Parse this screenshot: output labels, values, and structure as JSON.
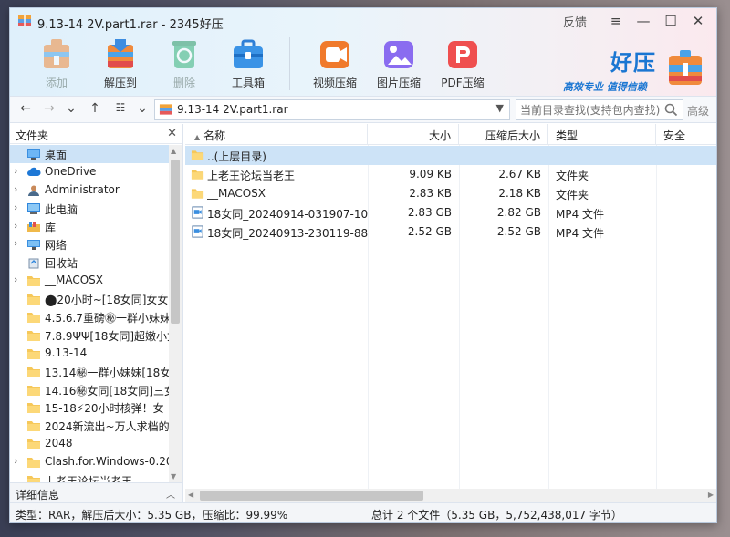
{
  "window": {
    "title": "9.13-14 2V.part1.rar - 2345好压",
    "feedback": "反馈"
  },
  "toolbar": {
    "items": [
      {
        "label": "添加",
        "icon": "add-icon",
        "disabled": true
      },
      {
        "label": "解压到",
        "icon": "extract-icon",
        "disabled": false
      },
      {
        "label": "删除",
        "icon": "delete-icon",
        "disabled": true
      },
      {
        "label": "工具箱",
        "icon": "toolbox-icon",
        "disabled": false
      },
      {
        "label": "视频压缩",
        "icon": "video-compress-icon",
        "disabled": false
      },
      {
        "label": "图片压缩",
        "icon": "image-compress-icon",
        "disabled": false
      },
      {
        "label": "PDF压缩",
        "icon": "pdf-compress-icon",
        "disabled": false
      }
    ]
  },
  "brand": {
    "name": "好压",
    "slogan": "高效专业 值得信赖"
  },
  "address": {
    "path": "9.13-14 2V.part1.rar",
    "search_placeholder": "当前目录查找(支持包内查找)",
    "advanced": "高级"
  },
  "left_panel": {
    "title": "文件夹",
    "tree": [
      {
        "label": "桌面",
        "icon": "desktop-icon",
        "expand": false,
        "selected": true
      },
      {
        "label": "OneDrive",
        "icon": "cloud-icon",
        "expand": true
      },
      {
        "label": "Administrator",
        "icon": "user-icon",
        "expand": true
      },
      {
        "label": "此电脑",
        "icon": "computer-icon",
        "expand": true
      },
      {
        "label": "库",
        "icon": "library-icon",
        "expand": true
      },
      {
        "label": "网络",
        "icon": "network-icon",
        "expand": true
      },
      {
        "label": "回收站",
        "icon": "recycle-bin-icon",
        "expand": false
      },
      {
        "label": "__MACOSX",
        "icon": "folder-icon",
        "expand": true
      },
      {
        "label": "⬤20小时~[18女同]女女",
        "icon": "folder-icon",
        "expand": false
      },
      {
        "label": "4.5.6.7重磅㊙一群小妹妹",
        "icon": "folder-icon",
        "expand": false
      },
      {
        "label": "7.8.9ΨΨ[18女同]超嫩小女",
        "icon": "folder-icon",
        "expand": false
      },
      {
        "label": "9.13-14",
        "icon": "folder-icon",
        "expand": false
      },
      {
        "label": "13.14㊙一群小妹妹[18女",
        "icon": "folder-icon",
        "expand": false
      },
      {
        "label": "14.16㊙女同[18女同]三女",
        "icon": "folder-icon",
        "expand": false
      },
      {
        "label": "15-18⚡20小时核弹！女",
        "icon": "folder-icon",
        "expand": false
      },
      {
        "label": "2024新流出~万人求档的",
        "icon": "folder-icon",
        "expand": false
      },
      {
        "label": "2048",
        "icon": "folder-icon",
        "expand": false
      },
      {
        "label": "Clash.for.Windows-0.20",
        "icon": "folder-icon",
        "expand": true
      },
      {
        "label": "上老王论坛当老王",
        "icon": "folder-icon",
        "expand": false
      }
    ],
    "detail_label": "详细信息"
  },
  "file_list": {
    "columns": {
      "name": "名称",
      "size": "大小",
      "packed": "压缩后大小",
      "type": "类型",
      "security": "安全"
    },
    "rows": [
      {
        "name": "..(上层目录)",
        "size": "",
        "packed": "",
        "type": "",
        "icon": "folder-icon",
        "selected": true
      },
      {
        "name": "上老王论坛当老王",
        "size": "9.09 KB",
        "packed": "2.67 KB",
        "type": "文件夹",
        "icon": "folder-icon"
      },
      {
        "name": "__MACOSX",
        "size": "2.83 KB",
        "packed": "2.18 KB",
        "type": "文件夹",
        "icon": "folder-icon"
      },
      {
        "name": "18女同_20240914-031907-10...",
        "size": "2.83 GB",
        "packed": "2.82 GB",
        "type": "MP4 文件",
        "icon": "video-file-icon"
      },
      {
        "name": "18女同_20240913-230119-88...",
        "size": "2.52 GB",
        "packed": "2.52 GB",
        "type": "MP4 文件",
        "icon": "video-file-icon"
      }
    ]
  },
  "status": {
    "left": "类型：RAR，解压后大小：5.35 GB，压缩比：99.99%",
    "right": "总计 2 个文件（5.35 GB，5,752,438,017 字节）"
  },
  "colors": {
    "accent": "#1a76d2",
    "selection": "#cde3f7",
    "folder": "#f6c85a"
  }
}
